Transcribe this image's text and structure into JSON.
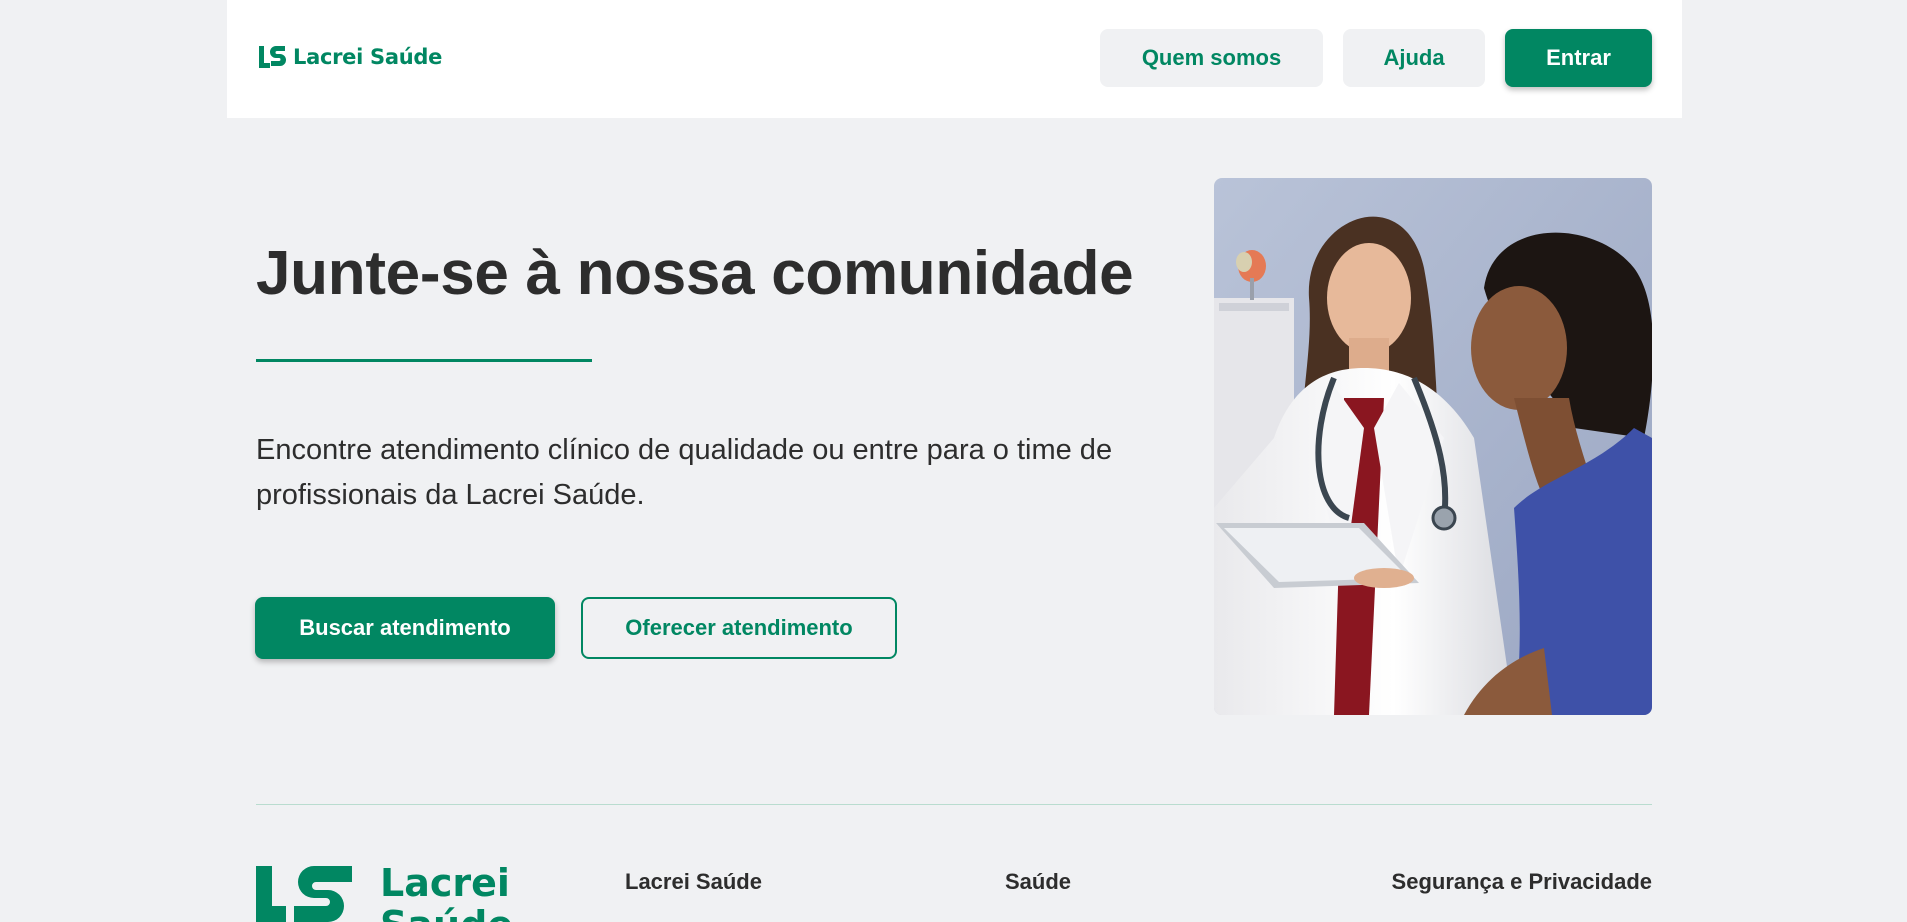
{
  "brand": {
    "name": "Lacrei Saúde",
    "accent": "#018762",
    "footer_logo_line1": "Lacrei",
    "footer_logo_line2": "Saúde"
  },
  "nav": {
    "about_label": "Quem somos",
    "help_label": "Ajuda",
    "login_label": "Entrar"
  },
  "hero": {
    "title": "Junte-se à nossa comunidade",
    "subtitle": "Encontre atendimento clínico de qualidade ou entre para o time de profissionais da Lacrei Saúde.",
    "primary_cta": "Buscar atendimento",
    "secondary_cta": "Oferecer atendimento",
    "image_icon": "photo-doctor-patient"
  },
  "footer": {
    "columns": [
      {
        "heading": "Lacrei Saúde"
      },
      {
        "heading": "Saúde"
      },
      {
        "heading": "Segurança e Privacidade"
      }
    ]
  }
}
